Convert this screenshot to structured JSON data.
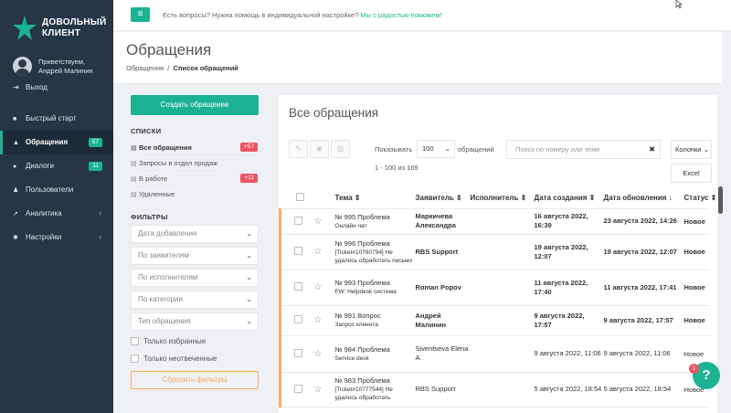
{
  "brand": {
    "line1": "ДОВОЛЬНЫЙ",
    "line2": "КЛИЕНТ",
    "accent": "#1cb394"
  },
  "user": {
    "greeting": "Приветствуем,",
    "name": "Андрей Малинин"
  },
  "exit_label": "Выход",
  "nav": [
    {
      "label": "Быстрый старт",
      "icon": "briefcase-icon",
      "badge": "",
      "arrow": ""
    },
    {
      "label": "Обращения",
      "icon": "warning-icon",
      "badge": "57",
      "arrow": ""
    },
    {
      "label": "Диалоги",
      "icon": "chat-icon",
      "badge": "11",
      "arrow": ""
    },
    {
      "label": "Пользователи",
      "icon": "users-icon",
      "badge": "",
      "arrow": ""
    },
    {
      "label": "Аналитика",
      "icon": "chart-icon",
      "badge": "",
      "arrow": "‹"
    },
    {
      "label": "Настройки",
      "icon": "gear-icon",
      "badge": "",
      "arrow": "‹"
    }
  ],
  "topbar": {
    "question": "Есть вопросы? Нужна помощь в индивидуальной настройке?",
    "link": "Мы с радостью поможем!"
  },
  "page": {
    "title": "Обращения",
    "crumb_parent": "Обращения",
    "crumb_current": "Список обращений"
  },
  "left": {
    "create_label": "Создать обращение",
    "lists_title": "СПИСКИ",
    "lists": [
      {
        "label": "Все обращения",
        "badge": "+57"
      },
      {
        "label": "Запросы в отдел продаж",
        "badge": ""
      },
      {
        "label": "В работе",
        "badge": "+11"
      },
      {
        "label": "Удаленные",
        "badge": ""
      }
    ],
    "filters_title": "ФИЛЬТРЫ",
    "filters": [
      "Дата добавления",
      "По заявителям",
      "По исполнителям",
      "По категории",
      "Тип обращения"
    ],
    "only_favorites": "Только избранные",
    "only_unanswered": "Только неотвеченные",
    "reset_label": "Сбросить фильтры"
  },
  "main": {
    "title": "Все обращения",
    "show_label": "Показывать",
    "per_page": "100",
    "per_page_suffix": "обращений",
    "range": "1 - 100 из 169",
    "search_placeholder": "Поиск по номеру или теме",
    "columns_label": "Колонки",
    "excel_label": "Excel",
    "headers": {
      "topic": "Тема ⇕",
      "requester": "Заявитель ⇕",
      "assignee": "Исполнитель ⇕",
      "created": "Дата создания ⇕",
      "updated": "Дата обновления",
      "status": "Статус ⇕"
    },
    "rows": [
      {
        "num": "№ 995 Проблема",
        "sub": "Онлайн чат",
        "requester": "Маркичева Александра",
        "assignee": "",
        "created": "16 августа 2022, 16:39",
        "updated": "23 августа 2022, 14:26",
        "status": "Новое",
        "bold": true
      },
      {
        "num": "№ 996 Проблема",
        "sub": "[Ticket#10780794] Не удалось обработать письмо",
        "requester": "RBS Support",
        "assignee": "",
        "created": "19 августа 2022, 12:07",
        "updated": "19 августа 2022, 12:07",
        "status": "Новое",
        "bold": true
      },
      {
        "num": "№ 993 Проблема",
        "sub": "FW: Helpdesk система",
        "requester": "Roman Popov",
        "assignee": "",
        "created": "11 августа 2022, 17:40",
        "updated": "11 августа 2022, 17:41",
        "status": "Новое",
        "bold": true
      },
      {
        "num": "№ 991 Вопрос",
        "sub": "Запрос клиента",
        "requester": "Андрей Малинин",
        "assignee": "",
        "created": "9 августа 2022, 17:57",
        "updated": "9 августа 2022, 17:57",
        "status": "Новое",
        "bold": true
      },
      {
        "num": "№ 984 Проблема",
        "sub": "Service desk",
        "requester": "Siventseva Elena A.",
        "assignee": "",
        "created": "9 августа 2022, 11:06",
        "updated": "9 августа 2022, 11:06",
        "status": "Новое",
        "bold": false
      },
      {
        "num": "№ 983 Проблема",
        "sub": "[Ticket#10777544] Не удалось обработать",
        "requester": "RBS Support",
        "assignee": "",
        "created": "5 августа 2022, 18:54",
        "updated": "5 августа 2022, 18:54",
        "status": "Новое",
        "bold": false
      }
    ]
  },
  "help_badge": "1",
  "help_icon": "?"
}
